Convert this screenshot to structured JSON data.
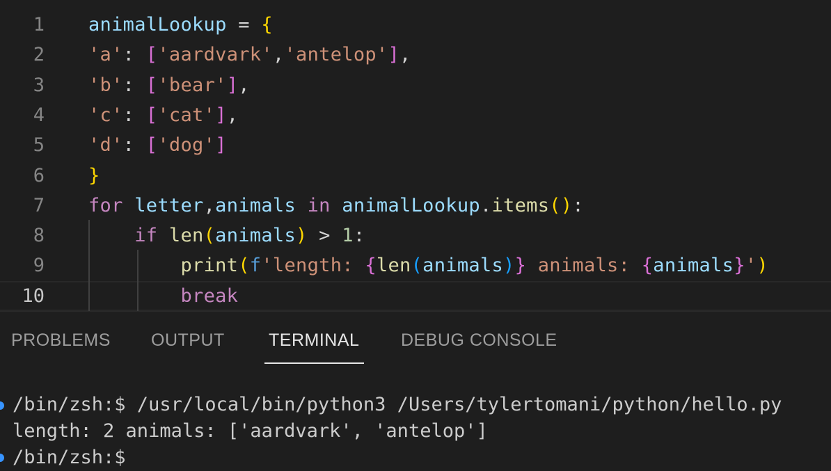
{
  "editor": {
    "lines": [
      {
        "num": "1",
        "tokens": [
          [
            "var",
            "animalLookup"
          ],
          [
            "op",
            " = "
          ],
          [
            "brace",
            "{"
          ]
        ]
      },
      {
        "num": "2",
        "tokens": [
          [
            "str",
            "'a'"
          ],
          [
            "op",
            ": "
          ],
          [
            "brack",
            "["
          ],
          [
            "str",
            "'aardvark'"
          ],
          [
            "op",
            ","
          ],
          [
            "str",
            "'antelop'"
          ],
          [
            "brack",
            "]"
          ],
          [
            "op",
            ","
          ]
        ]
      },
      {
        "num": "3",
        "tokens": [
          [
            "str",
            "'b'"
          ],
          [
            "op",
            ": "
          ],
          [
            "brack",
            "["
          ],
          [
            "str",
            "'bear'"
          ],
          [
            "brack",
            "]"
          ],
          [
            "op",
            ","
          ]
        ]
      },
      {
        "num": "4",
        "tokens": [
          [
            "str",
            "'c'"
          ],
          [
            "op",
            ": "
          ],
          [
            "brack",
            "["
          ],
          [
            "str",
            "'cat'"
          ],
          [
            "brack",
            "]"
          ],
          [
            "op",
            ","
          ]
        ]
      },
      {
        "num": "5",
        "tokens": [
          [
            "str",
            "'d'"
          ],
          [
            "op",
            ": "
          ],
          [
            "brack",
            "["
          ],
          [
            "str",
            "'dog'"
          ],
          [
            "brack",
            "]"
          ]
        ]
      },
      {
        "num": "6",
        "tokens": [
          [
            "brace",
            "}"
          ]
        ]
      },
      {
        "num": "7",
        "tokens": [
          [
            "kw",
            "for "
          ],
          [
            "var",
            "letter"
          ],
          [
            "op",
            ","
          ],
          [
            "var",
            "animals"
          ],
          [
            "kw",
            " in "
          ],
          [
            "var",
            "animalLookup"
          ],
          [
            "op",
            "."
          ],
          [
            "fn",
            "items"
          ],
          [
            "paren",
            "()"
          ],
          [
            "op",
            ":"
          ]
        ]
      },
      {
        "num": "8",
        "tokens": [
          [
            "op",
            "    "
          ],
          [
            "kw",
            "if "
          ],
          [
            "fn",
            "len"
          ],
          [
            "paren",
            "("
          ],
          [
            "var",
            "animals"
          ],
          [
            "paren",
            ")"
          ],
          [
            "op",
            " > "
          ],
          [
            "num",
            "1"
          ],
          [
            "op",
            ":"
          ]
        ]
      },
      {
        "num": "9",
        "tokens": [
          [
            "op",
            "        "
          ],
          [
            "fn",
            "print"
          ],
          [
            "paren",
            "("
          ],
          [
            "fstr",
            "f"
          ],
          [
            "str",
            "'length: "
          ],
          [
            "paren2",
            "{"
          ],
          [
            "fn",
            "len"
          ],
          [
            "paren3",
            "("
          ],
          [
            "var",
            "animals"
          ],
          [
            "paren3",
            ")"
          ],
          [
            "paren2",
            "}"
          ],
          [
            "str",
            " animals: "
          ],
          [
            "paren2",
            "{"
          ],
          [
            "var",
            "animals"
          ],
          [
            "paren2",
            "}"
          ],
          [
            "str",
            "'"
          ],
          [
            "paren",
            ")"
          ]
        ]
      },
      {
        "num": "10",
        "tokens": [
          [
            "op",
            "        "
          ],
          [
            "kw",
            "break"
          ]
        ]
      }
    ],
    "active_line": "10"
  },
  "panel": {
    "tabs": [
      "PROBLEMS",
      "OUTPUT",
      "TERMINAL",
      "DEBUG CONSOLE"
    ],
    "active_tab": "TERMINAL"
  },
  "terminal": {
    "lines": [
      "/bin/zsh:$ /usr/local/bin/python3 /Users/tylertomani/python/hello.py",
      "length: 2 animals: ['aardvark', 'antelop']",
      "/bin/zsh:$ "
    ]
  }
}
